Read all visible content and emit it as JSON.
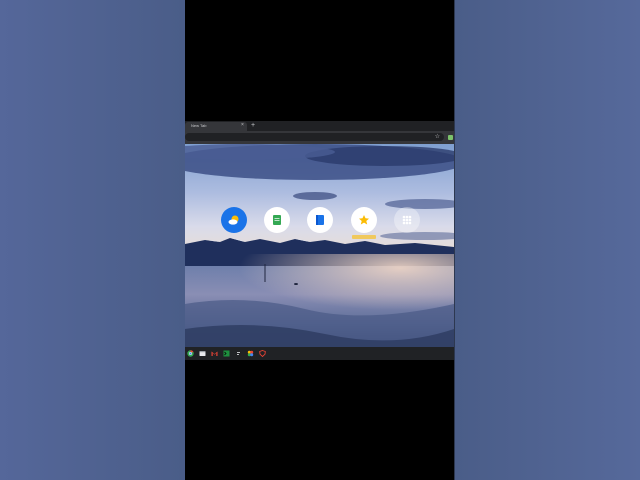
{
  "browser": {
    "tab_title": "New Tab",
    "tab_close": "×",
    "new_tab": "+",
    "bookmark_star": "☆"
  },
  "desktop": {
    "app_icons": [
      "weather-icon",
      "notes-icon",
      "docs-icon",
      "bookmarks-icon",
      "apps-grid-icon"
    ]
  },
  "taskbar": {
    "icons": [
      "chrome-icon",
      "files-icon",
      "gmail-icon",
      "terminal-icon",
      "text-icon",
      "photos-icon",
      "antivirus-icon"
    ]
  },
  "colors": {
    "frame_bg": "#4f628c",
    "browser_chrome": "#202124",
    "toolbar": "#35363a",
    "accent_blue": "#1a73e8",
    "accent_green": "#34a853",
    "accent_yellow": "#fbbc04"
  }
}
